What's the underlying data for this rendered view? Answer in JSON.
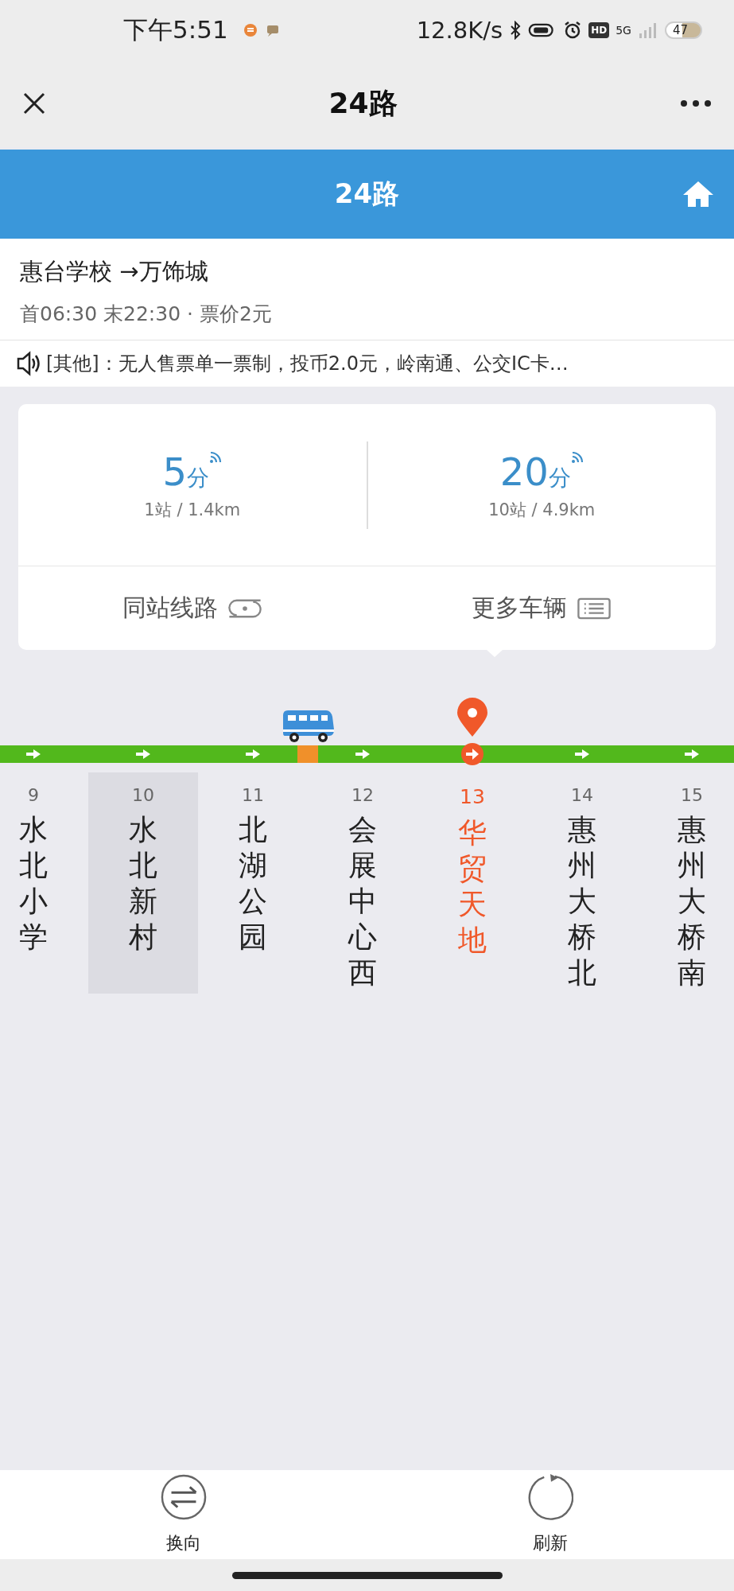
{
  "status_bar": {
    "time": "下午5:51",
    "speed": "12.8K/s",
    "hd": "HD",
    "network": "5G",
    "battery": "47"
  },
  "title_bar": {
    "title": "24路"
  },
  "header": {
    "title": "24路"
  },
  "route": {
    "name": "惠台学校 →万饰城",
    "schedule": "首06:30 末22:30 · 票价2元"
  },
  "notice": {
    "text": "[其他]：无人售票单一票制，投币2.0元，岭南通、公交IC卡…"
  },
  "arrivals": [
    {
      "minutes": "5",
      "unit": "分",
      "detail": "1站 / 1.4km"
    },
    {
      "minutes": "20",
      "unit": "分",
      "detail": "10站 / 4.9km"
    }
  ],
  "actions": [
    {
      "kind": "lines",
      "label": "同站线路"
    },
    {
      "kind": "vehicles",
      "label": "更多车辆"
    }
  ],
  "stations": [
    {
      "number": "9",
      "name": "水北小学",
      "selected": false,
      "highlighted": false,
      "bus_after": false
    },
    {
      "number": "10",
      "name": "水北新村",
      "selected": false,
      "highlighted": true,
      "bus_after": false
    },
    {
      "number": "11",
      "name": "北湖公园",
      "selected": false,
      "highlighted": false,
      "bus_after": true
    },
    {
      "number": "12",
      "name": "会展中心西",
      "selected": false,
      "highlighted": false,
      "bus_after": false
    },
    {
      "number": "13",
      "name": "华贸天地",
      "selected": true,
      "highlighted": false,
      "bus_after": false
    },
    {
      "number": "14",
      "name": "惠州大桥北",
      "selected": false,
      "highlighted": false,
      "bus_after": false
    },
    {
      "number": "15",
      "name": "惠州大桥南",
      "selected": false,
      "highlighted": false,
      "bus_after": false
    }
  ],
  "bottom_bar": [
    {
      "kind": "swap",
      "label": "换向"
    },
    {
      "kind": "refresh",
      "label": "刷新"
    }
  ]
}
